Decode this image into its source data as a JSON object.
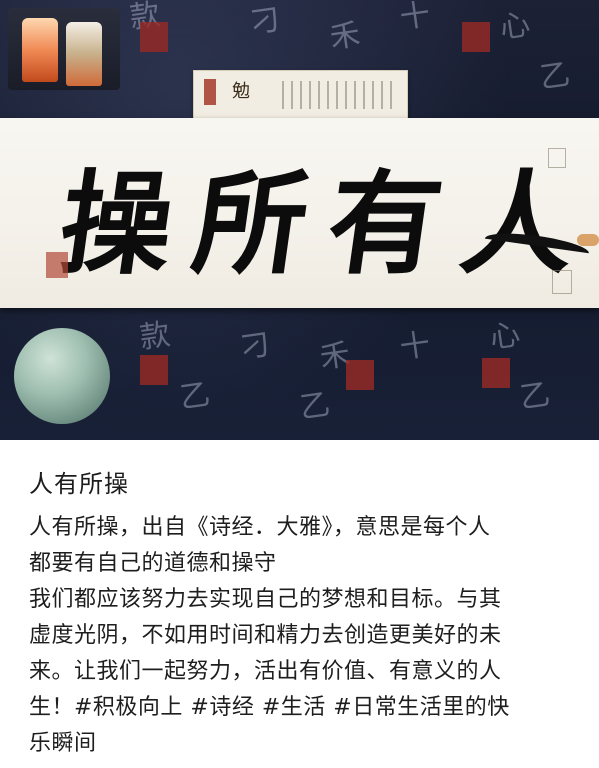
{
  "post": {
    "title": "人有所操",
    "body_lines": [
      "人有所操，出自《诗经．大雅》，意思是每个人",
      "都要有自己的道德和操守",
      "我们都应该努力去实现自己的梦想和目标。与其",
      "虚度光阴，不如用时间和精力去创造更美好的未",
      "来。让我们一起努力，活出有价值、有意义的人",
      "生！#积极向上 #诗经 #生活 #日常生活里的快",
      "乐瞬间"
    ]
  },
  "photo": {
    "calligraphy_text": "操所有人"
  }
}
